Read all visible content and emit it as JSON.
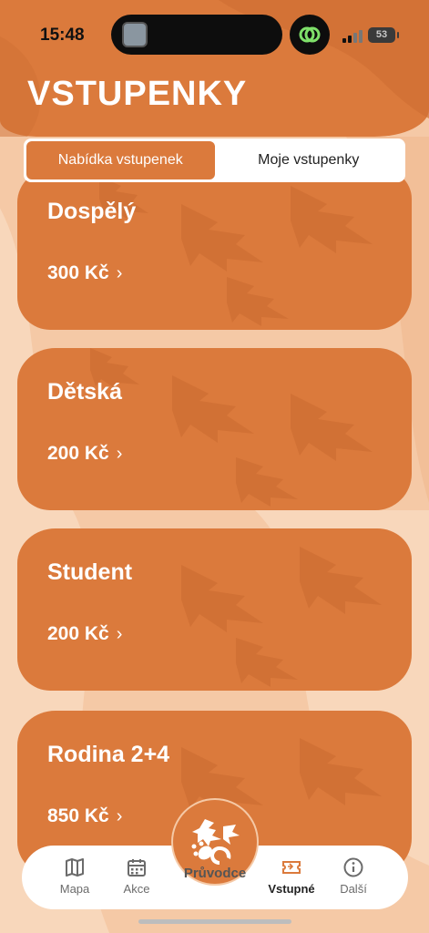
{
  "status_bar": {
    "time": "15:48",
    "battery": "53"
  },
  "header": {
    "title": "VSTUPENKY"
  },
  "segments": [
    {
      "label": "Nabídka vstupenek",
      "active": true
    },
    {
      "label": "Moje vstupenky",
      "active": false
    }
  ],
  "tickets": [
    {
      "name": "Dospělý",
      "price": "300 Kč"
    },
    {
      "name": "Dětská",
      "price": "200 Kč"
    },
    {
      "name": "Student",
      "price": "200 Kč"
    },
    {
      "name": "Rodina 2+4",
      "price": "850 Kč"
    }
  ],
  "tabbar": {
    "items": [
      {
        "label": "Mapa",
        "icon": "map-icon"
      },
      {
        "label": "Akce",
        "icon": "calendar-icon"
      },
      {
        "label": "Průvodce",
        "icon": "guide-logo-icon"
      },
      {
        "label": "Vstupné",
        "icon": "ticket-icon",
        "active": true
      },
      {
        "label": "Další",
        "icon": "info-icon"
      }
    ]
  },
  "colors": {
    "accent": "#db7a3c",
    "background": "#f5c9a6",
    "tab_active": "#db7a3c"
  }
}
